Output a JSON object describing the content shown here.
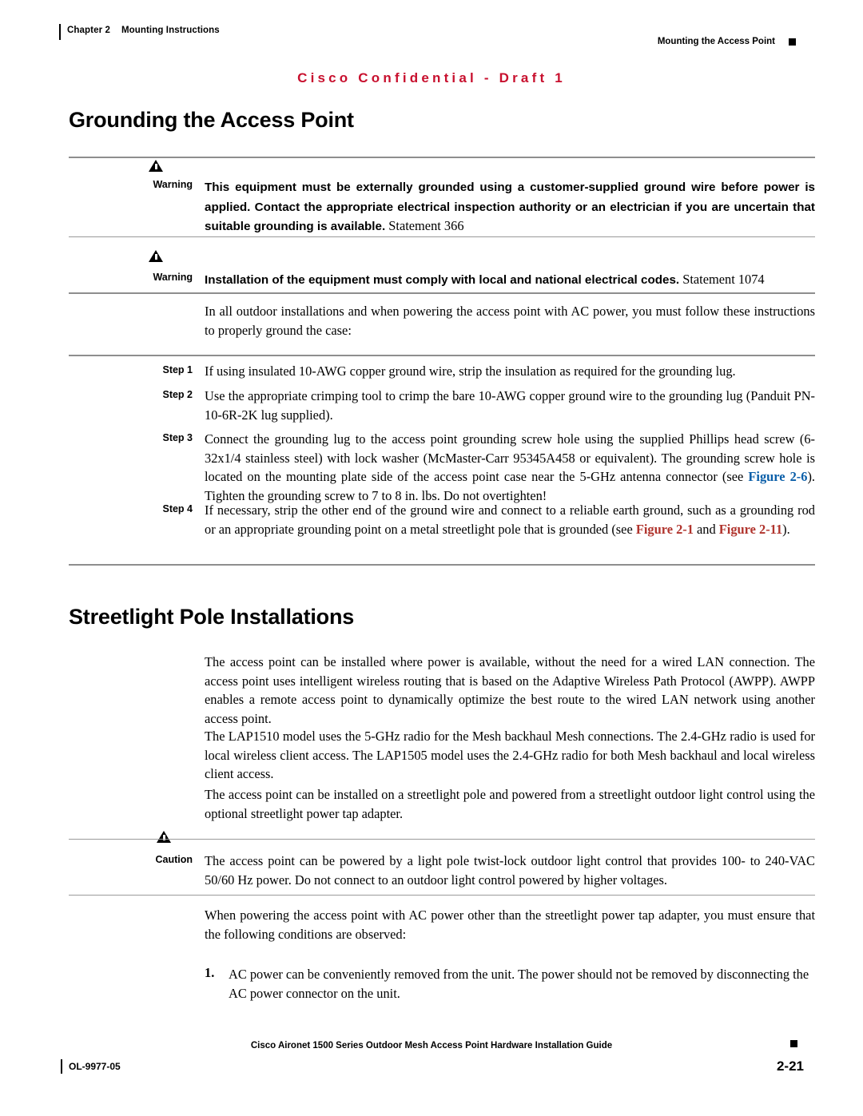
{
  "header": {
    "chapter": "Chapter 2",
    "chapter_title": "Mounting Instructions",
    "right_title": "Mounting the Access Point"
  },
  "draft_banner": "Cisco Confidential - Draft 1",
  "sections": {
    "grounding": {
      "title": "Grounding the Access Point",
      "warning1_label": "Warning",
      "warning1_bold": "This equipment must be externally grounded using a customer-supplied ground wire before power is applied. Contact the appropriate electrical inspection authority or an electrician if you are uncertain that suitable grounding is available.",
      "warning1_statement": " Statement 366",
      "warning2_label": "Warning",
      "warning2_bold": "Installation of the equipment must comply with local and national electrical codes.",
      "warning2_statement": " Statement 1074",
      "intro": "In all outdoor installations and when powering the access point with AC power, you must follow these instructions to properly ground the case:",
      "steps": [
        {
          "label": "Step 1",
          "text": "If using insulated 10-AWG copper ground wire, strip the insulation as required for the grounding lug."
        },
        {
          "label": "Step 2",
          "text": "Use the appropriate crimping tool to crimp the bare 10-AWG copper ground wire to the grounding lug (Panduit PN-10-6R-2K lug supplied)."
        },
        {
          "label": "Step 3",
          "text_part1": "Connect the grounding lug to the access point grounding screw hole using the supplied Phillips head screw (6-32x1/4 stainless steel) with lock washer (McMaster-Carr 95345A458 or equivalent). The grounding screw hole is located on the mounting plate side of the access point case near the 5-GHz antenna connector (see ",
          "link1": "Figure 2-6",
          "text_part2": "). Tighten the grounding screw to 7 to 8 in. lbs. Do not overtighten!"
        },
        {
          "label": "Step 4",
          "text_part1": "If necessary, strip the other end of the ground wire and connect to a reliable earth ground, such as a grounding rod or an appropriate grounding point on a metal streetlight pole that is grounded (see ",
          "link1": "Figure 2-1",
          "text_mid": " and ",
          "link2": "Figure 2-11",
          "text_part2": ")."
        }
      ]
    },
    "streetlight": {
      "title": "Streetlight Pole Installations",
      "para1": "The access point can be installed where power is available, without the need for a wired LAN connection. The access point uses intelligent wireless routing that is based on the Adaptive Wireless Path Protocol (AWPP). AWPP enables a remote access point to dynamically optimize the best route to the wired LAN network using another access point.",
      "para2": "The LAP1510 model uses the 5-GHz radio for the Mesh backhaul Mesh connections. The 2.4-GHz radio is used for local wireless client access. The LAP1505 model uses the 2.4-GHz radio for both Mesh backhaul and local wireless client access.",
      "para3": "The access point can be installed on a streetlight pole and powered from a streetlight outdoor light control using the optional streetlight power tap adapter.",
      "caution_label": "Caution",
      "caution_text": "The access point can be powered by a light pole twist-lock outdoor light control that provides 100- to 240-VAC 50/60 Hz power. Do not connect to an outdoor light control powered by higher voltages.",
      "para4": "When powering the access point with AC power other than the streetlight power tap adapter, you must ensure that the following conditions are observed:",
      "numbered": [
        {
          "num": "1.",
          "text": "AC power can be conveniently removed from the unit. The power should not be removed by disconnecting the AC power connector on the unit."
        }
      ]
    }
  },
  "footer": {
    "doc_id": "OL-9977-05",
    "title": "Cisco Aironet 1500 Series Outdoor Mesh Access Point Hardware Installation Guide",
    "page_number": "2-21"
  }
}
